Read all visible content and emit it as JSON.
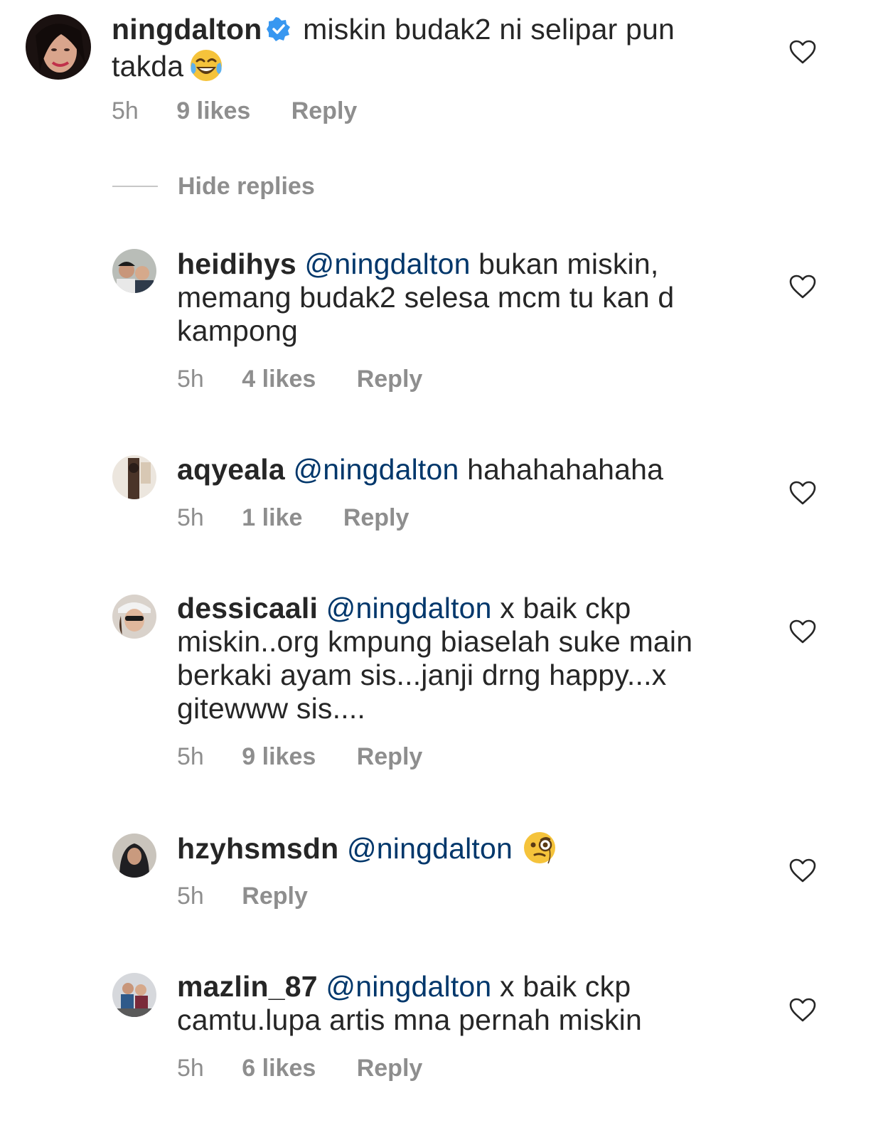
{
  "main_comment": {
    "username": "ningdalton",
    "verified": true,
    "text": "miskin budak2 ni selipar pun takda",
    "emoji": "face-with-tears-of-joy",
    "time": "5h",
    "likes": "9 likes",
    "reply": "Reply"
  },
  "hide_replies_label": "Hide replies",
  "replies": [
    {
      "username": "heidihys",
      "mention": "@ningdalton",
      "text": "bukan miskin, memang budak2 selesa mcm tu kan d kampong",
      "time": "5h",
      "likes": "4 likes",
      "reply": "Reply"
    },
    {
      "username": "aqyeala",
      "mention": "@ningdalton",
      "text": "hahahahahaha",
      "time": "5h",
      "likes": "1 like",
      "reply": "Reply"
    },
    {
      "username": "dessicaali",
      "mention": "@ningdalton",
      "text": "x baik ckp miskin..org kmpung biaselah suke main berkaki ayam sis...janji drng happy...x gitewww sis....",
      "time": "5h",
      "likes": "9 likes",
      "reply": "Reply"
    },
    {
      "username": "hzyhsmsdn",
      "mention": "@ningdalton",
      "text": "",
      "emoji": "face-with-monocle",
      "time": "5h",
      "reply": "Reply"
    },
    {
      "username": "mazlin_87",
      "mention": "@ningdalton",
      "text": "x baik ckp camtu.lupa artis mna pernah miskin",
      "time": "5h",
      "likes": "6 likes",
      "reply": "Reply"
    }
  ],
  "colors": {
    "text": "#262626",
    "secondary": "#8e8e8e",
    "mention": "#00376b",
    "verified": "#3897f0",
    "divider": "#c7c7c7"
  }
}
